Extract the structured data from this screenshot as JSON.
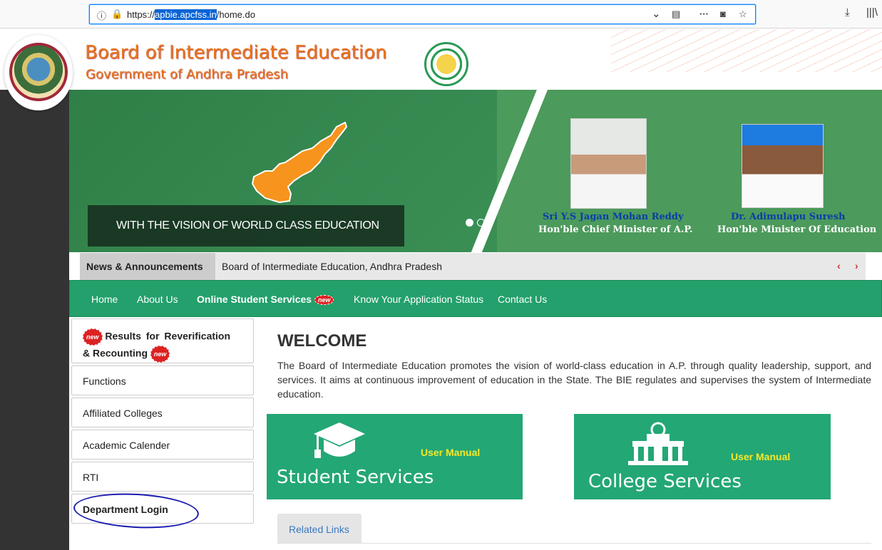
{
  "browser": {
    "url_prefix": "https://",
    "url_host": "apbie.apcfss.in",
    "url_path": "/home.do"
  },
  "header": {
    "title": "Board of Intermediate Education",
    "subtitle": "Government of Andhra Pradesh"
  },
  "banner": {
    "vision": "WITH THE VISION OF WORLD CLASS EDUCATION",
    "people": [
      {
        "name": "Sri Y.S Jagan Mohan Reddy",
        "role": "Hon'ble Chief Minister of A.P."
      },
      {
        "name": "Dr. Adimulapu Suresh",
        "role": "Hon'ble Minister Of Education"
      }
    ]
  },
  "news": {
    "label": "News & Announcements",
    "text": "Board of Intermediate Education, Andhra Pradesh",
    "prev": "‹",
    "next": "›"
  },
  "menu": {
    "home": "Home",
    "about": "About Us",
    "online": "Online Student Services",
    "status": "Know Your Application Status",
    "contact": "Contact Us",
    "new_badge": "new"
  },
  "sidebar": {
    "first_a": "Results for Reverification",
    "first_b": "& Recounting",
    "items": [
      "Functions",
      "Affiliated Colleges",
      "Academic Calender",
      "RTI",
      "Department Login"
    ]
  },
  "main": {
    "welcome": "WELCOME",
    "intro": "The Board of Intermediate Education promotes the vision of world-class education in A.P. through quality leadership, support, and services. It aims at continuous improvement of education in the State. The BIE regulates and supervises the system of Intermediate education.",
    "student_title": "Student Services",
    "college_title": "College Services",
    "manual": "User Manual",
    "related": "Related Links"
  }
}
